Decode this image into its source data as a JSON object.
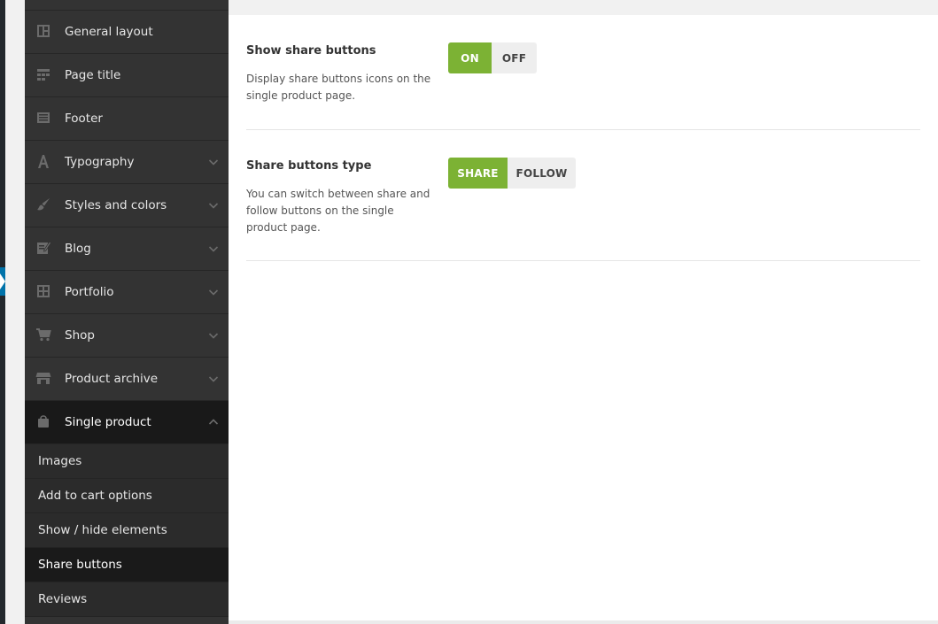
{
  "sidebar": {
    "items": [
      {
        "label": "General layout",
        "icon": "layout-icon",
        "expandable": false
      },
      {
        "label": "Page title",
        "icon": "grid-icon",
        "expandable": false
      },
      {
        "label": "Footer",
        "icon": "footer-icon",
        "expandable": false
      },
      {
        "label": "Typography",
        "icon": "font-icon",
        "expandable": true
      },
      {
        "label": "Styles and colors",
        "icon": "brush-icon",
        "expandable": true
      },
      {
        "label": "Blog",
        "icon": "edit-icon",
        "expandable": true
      },
      {
        "label": "Portfolio",
        "icon": "portfolio-icon",
        "expandable": true
      },
      {
        "label": "Shop",
        "icon": "cart-icon",
        "expandable": true
      },
      {
        "label": "Product archive",
        "icon": "store-icon",
        "expandable": true
      },
      {
        "label": "Single product",
        "icon": "bag-icon",
        "expandable": true,
        "expanded": true,
        "active": true
      }
    ],
    "subitems": [
      {
        "label": "Images"
      },
      {
        "label": "Add to cart options"
      },
      {
        "label": "Show / hide elements"
      },
      {
        "label": "Share buttons",
        "active": true
      },
      {
        "label": "Reviews"
      }
    ]
  },
  "settings": {
    "show_share": {
      "title": "Show share buttons",
      "description": "Display share buttons icons on the single product page.",
      "on_label": "ON",
      "off_label": "OFF",
      "selected": "ON"
    },
    "share_type": {
      "title": "Share buttons type",
      "description": "You can switch between share and follow buttons on the single product page.",
      "share_label": "SHARE",
      "follow_label": "FOLLOW",
      "selected": "SHARE"
    }
  },
  "colors": {
    "accent": "#7cb234",
    "sidebar_bg": "#333333",
    "sidebar_active": "#191919"
  }
}
